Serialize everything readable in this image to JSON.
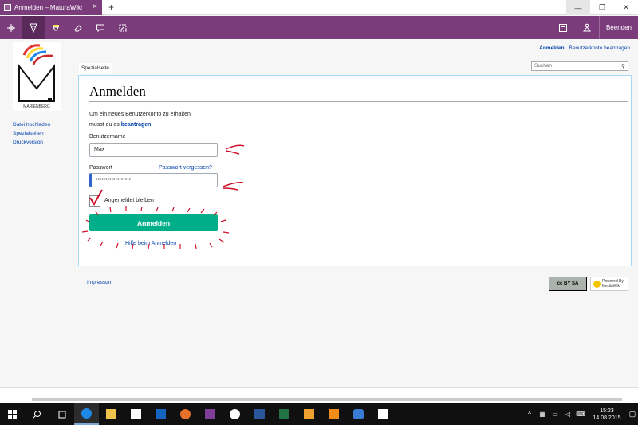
{
  "browser": {
    "tab_title": "Anmelden – MaturaWiki",
    "tab_close": "×",
    "new_tab": "+",
    "window_controls": [
      "—",
      "❐",
      "✕"
    ],
    "quit_label": "Beenden"
  },
  "ink_toolbar": {
    "tools": [
      "pan-icon",
      "pen-icon",
      "highlighter-icon",
      "eraser-icon",
      "comment-icon",
      "clip-icon"
    ],
    "right_tools": [
      "save-icon",
      "share-icon"
    ]
  },
  "wiki": {
    "logo_text": "MARIENBERG",
    "personal": {
      "login": "Anmelden",
      "create_account": "Benutzerkonto beantragen"
    },
    "page_tab": "Spezialseite",
    "search_placeholder": "Suchen",
    "sidebar": [
      "Datei hochladen",
      "Spezialseiten",
      "Druckversion"
    ],
    "title": "Anmelden",
    "intro_line1": "Um ein neues Benutzerkonto zu erhalten,",
    "intro_line2_prefix": "musst du es ",
    "intro_link": "beantragen",
    "intro_suffix": ".",
    "username_label": "Benutzername",
    "username_value": "Max",
    "password_label": "Passwort",
    "password_forgot": "Passwort vergessen?",
    "password_value": "••••••••••••••••••",
    "remember_label": "Angemeldet bleiben",
    "login_button": "Anmelden",
    "help_link": "Hilfe beim Anmelden",
    "footer_link": "Impressum",
    "cc_badge": "cc BY SA",
    "mw_badge": "Powered By MediaWiki"
  },
  "taskbar": {
    "time": "15:23",
    "date": "14.08.2015",
    "colors": [
      "#1e88e5",
      "#f0c24b",
      "#ffffff",
      "#1565c0",
      "#e8702a",
      "#7e3d97",
      "#ffffff",
      "#2b579a",
      "#217346",
      "#f0a030",
      "#f08c1a",
      "#3a7bd5",
      "#ffffff"
    ]
  }
}
